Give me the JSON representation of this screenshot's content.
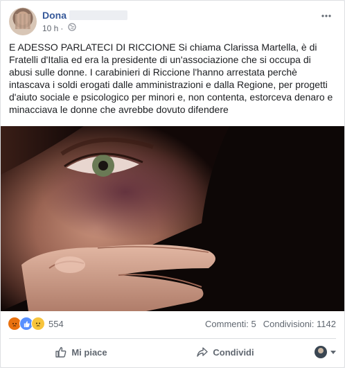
{
  "post": {
    "author": "Dona",
    "time": "10 h",
    "privacy_icon": "globe-icon",
    "more_icon": "more-options-icon",
    "text": "E ADESSO PARLATECI DI RICCIONE Si chiama Clarissa Martella, è di Fratelli d'Italia ed era la presidente di un'associazione che si occupa di abusi sulle donne. I carabinieri di Riccione l'hanno arrestata perchè intascava i soldi erogati dalle amministrazioni e dalla Regione, per progetti d'aiuto sociale e psicologico per minori e, non contenta, estorceva denaro e minacciava le donne che avrebbe dovuto difendere"
  },
  "reactions": {
    "icons": [
      "angry-reaction-icon",
      "like-reaction-icon",
      "sad-reaction-icon"
    ],
    "count": "554",
    "comments": "Commenti: 5",
    "shares": "Condivisioni: 1142"
  },
  "actions": {
    "like": "Mi piace",
    "share": "Condividi"
  },
  "colors": {
    "author_link": "#365899",
    "secondary_text": "#616770",
    "angry": "#e9710f",
    "like": "#5890ff",
    "sad": "#f7c43c"
  }
}
